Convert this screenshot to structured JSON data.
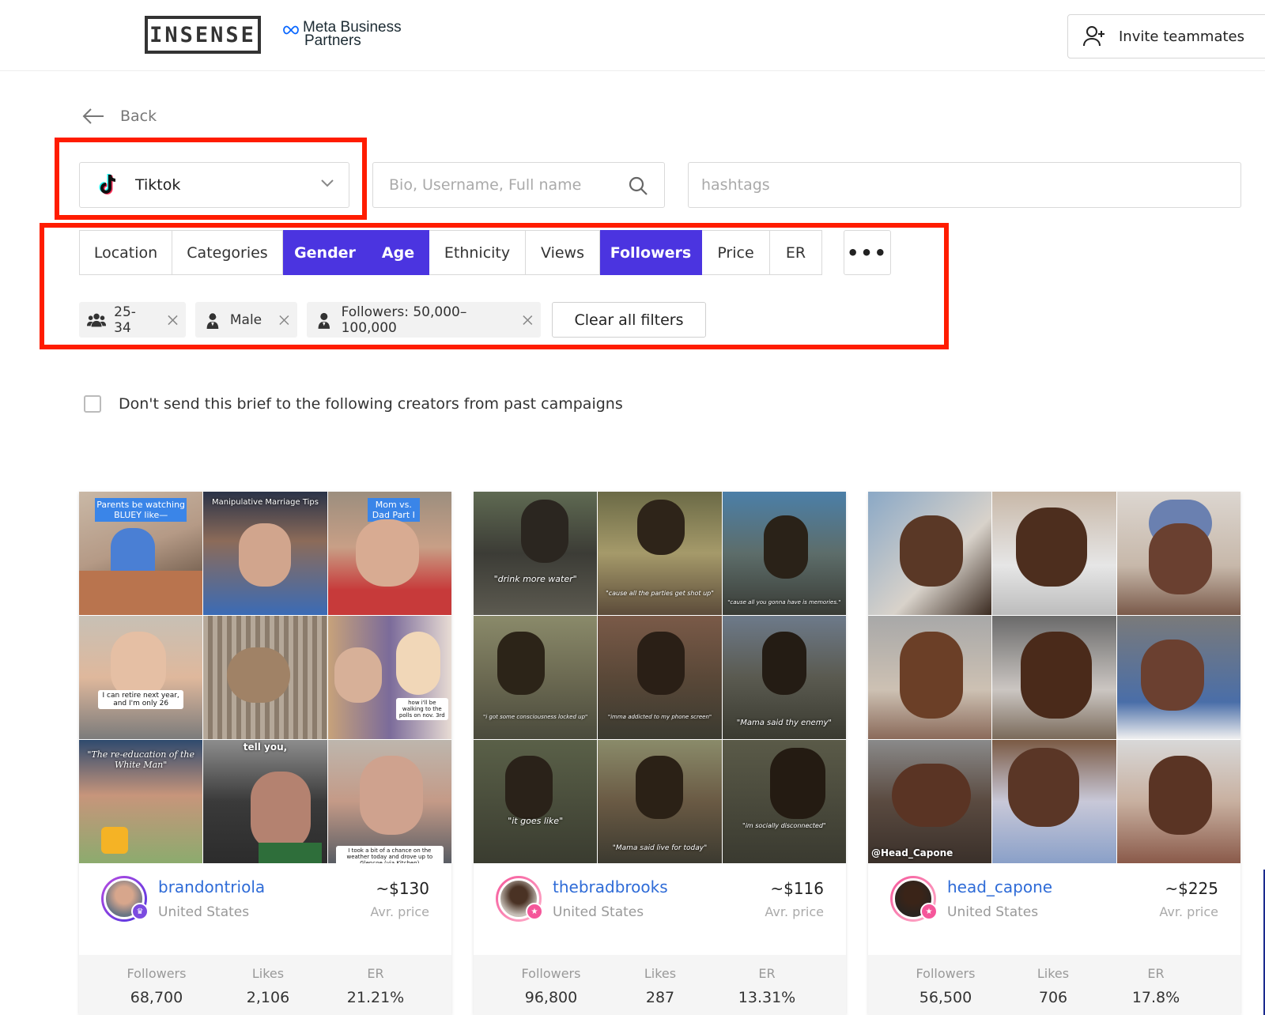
{
  "header": {
    "logo": "INSENSE",
    "meta_line1": "Meta Business",
    "meta_line2": "Partners",
    "invite_label": "Invite teammates"
  },
  "back_label": "Back",
  "platform": {
    "selected": "Tiktok"
  },
  "search": {
    "placeholder": "Bio, Username, Full name"
  },
  "hashtags": {
    "placeholder": "hashtags"
  },
  "filter_tabs": [
    {
      "label": "Location",
      "active": false
    },
    {
      "label": "Categories",
      "active": false
    },
    {
      "label": "Gender",
      "active": true
    },
    {
      "label": "Age",
      "active": true
    },
    {
      "label": "Ethnicity",
      "active": false
    },
    {
      "label": "Views",
      "active": false
    },
    {
      "label": "Followers",
      "active": true
    },
    {
      "label": "Price",
      "active": false
    },
    {
      "label": "ER",
      "active": false
    }
  ],
  "more_label": "•••",
  "chips": [
    {
      "label": "25-34",
      "icon": "group-icon"
    },
    {
      "label": "Male",
      "icon": "person-icon"
    },
    {
      "label": "Followers: 50,000–100,000",
      "icon": "person-icon"
    }
  ],
  "clear_label": "Clear all filters",
  "exclude_label": "Don't send this brief to the following creators from past campaigns",
  "accent_color": "#4b34e0",
  "highlight_color": "#ff1c00",
  "creators": [
    {
      "handle": "brandontriola",
      "country": "United States",
      "price": "~$130",
      "price_label": "Avr. price",
      "stats": [
        {
          "label": "Followers",
          "value": "68,700"
        },
        {
          "label": "Likes",
          "value": "2,106"
        },
        {
          "label": "ER",
          "value": "21.21%"
        }
      ],
      "captions": [
        "Parents be watching BLUEY like—",
        "Manipulative Marriage Tips",
        "Mom vs. Dad Part I",
        "I can retire next year, and I'm only 26",
        "",
        "how i'll be walking to the polls on nov. 3rd",
        "\"The re-education of the White Man\"",
        "tell you,",
        "I took a bit of a chance on the weather today and drove up to Glencoe (via Kitchen)"
      ]
    },
    {
      "handle": "thebradbrooks",
      "country": "United States",
      "price": "~$116",
      "price_label": "Avr. price",
      "stats": [
        {
          "label": "Followers",
          "value": "96,800"
        },
        {
          "label": "Likes",
          "value": "287"
        },
        {
          "label": "ER",
          "value": "13.31%"
        }
      ],
      "captions": [
        "\"drink more water\"",
        "\"cause all the parties get shot up\"",
        "\"cause all you gonna have is memories.\"",
        "\"i got some consciousness locked up\"",
        "\"imma addicted to my phone screen\"",
        "\"Mama said thy enemy\"",
        "\"it goes like\"",
        "\"Mama said live for today\"",
        "\"im socially disconnected\""
      ]
    },
    {
      "handle": "head_capone",
      "country": "United States",
      "price": "~$225",
      "price_label": "Avr. price",
      "stats": [
        {
          "label": "Followers",
          "value": "56,500"
        },
        {
          "label": "Likes",
          "value": "706"
        },
        {
          "label": "ER",
          "value": "17.8%"
        }
      ],
      "captions": [
        "",
        "",
        "",
        "",
        "",
        "",
        "@Head_Capone",
        "",
        ""
      ]
    }
  ]
}
